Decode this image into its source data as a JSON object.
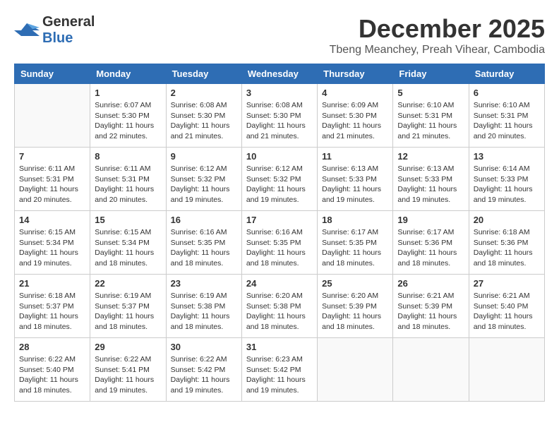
{
  "logo": {
    "general": "General",
    "blue": "Blue"
  },
  "title": {
    "month_year": "December 2025",
    "location": "Tbeng Meanchey, Preah Vihear, Cambodia"
  },
  "days_of_week": [
    "Sunday",
    "Monday",
    "Tuesday",
    "Wednesday",
    "Thursday",
    "Friday",
    "Saturday"
  ],
  "weeks": [
    [
      {
        "day": "",
        "info": ""
      },
      {
        "day": "1",
        "info": "Sunrise: 6:07 AM\nSunset: 5:30 PM\nDaylight: 11 hours\nand 22 minutes."
      },
      {
        "day": "2",
        "info": "Sunrise: 6:08 AM\nSunset: 5:30 PM\nDaylight: 11 hours\nand 21 minutes."
      },
      {
        "day": "3",
        "info": "Sunrise: 6:08 AM\nSunset: 5:30 PM\nDaylight: 11 hours\nand 21 minutes."
      },
      {
        "day": "4",
        "info": "Sunrise: 6:09 AM\nSunset: 5:30 PM\nDaylight: 11 hours\nand 21 minutes."
      },
      {
        "day": "5",
        "info": "Sunrise: 6:10 AM\nSunset: 5:31 PM\nDaylight: 11 hours\nand 21 minutes."
      },
      {
        "day": "6",
        "info": "Sunrise: 6:10 AM\nSunset: 5:31 PM\nDaylight: 11 hours\nand 20 minutes."
      }
    ],
    [
      {
        "day": "7",
        "info": "Sunrise: 6:11 AM\nSunset: 5:31 PM\nDaylight: 11 hours\nand 20 minutes."
      },
      {
        "day": "8",
        "info": "Sunrise: 6:11 AM\nSunset: 5:31 PM\nDaylight: 11 hours\nand 20 minutes."
      },
      {
        "day": "9",
        "info": "Sunrise: 6:12 AM\nSunset: 5:32 PM\nDaylight: 11 hours\nand 19 minutes."
      },
      {
        "day": "10",
        "info": "Sunrise: 6:12 AM\nSunset: 5:32 PM\nDaylight: 11 hours\nand 19 minutes."
      },
      {
        "day": "11",
        "info": "Sunrise: 6:13 AM\nSunset: 5:33 PM\nDaylight: 11 hours\nand 19 minutes."
      },
      {
        "day": "12",
        "info": "Sunrise: 6:13 AM\nSunset: 5:33 PM\nDaylight: 11 hours\nand 19 minutes."
      },
      {
        "day": "13",
        "info": "Sunrise: 6:14 AM\nSunset: 5:33 PM\nDaylight: 11 hours\nand 19 minutes."
      }
    ],
    [
      {
        "day": "14",
        "info": "Sunrise: 6:15 AM\nSunset: 5:34 PM\nDaylight: 11 hours\nand 19 minutes."
      },
      {
        "day": "15",
        "info": "Sunrise: 6:15 AM\nSunset: 5:34 PM\nDaylight: 11 hours\nand 18 minutes."
      },
      {
        "day": "16",
        "info": "Sunrise: 6:16 AM\nSunset: 5:35 PM\nDaylight: 11 hours\nand 18 minutes."
      },
      {
        "day": "17",
        "info": "Sunrise: 6:16 AM\nSunset: 5:35 PM\nDaylight: 11 hours\nand 18 minutes."
      },
      {
        "day": "18",
        "info": "Sunrise: 6:17 AM\nSunset: 5:35 PM\nDaylight: 11 hours\nand 18 minutes."
      },
      {
        "day": "19",
        "info": "Sunrise: 6:17 AM\nSunset: 5:36 PM\nDaylight: 11 hours\nand 18 minutes."
      },
      {
        "day": "20",
        "info": "Sunrise: 6:18 AM\nSunset: 5:36 PM\nDaylight: 11 hours\nand 18 minutes."
      }
    ],
    [
      {
        "day": "21",
        "info": "Sunrise: 6:18 AM\nSunset: 5:37 PM\nDaylight: 11 hours\nand 18 minutes."
      },
      {
        "day": "22",
        "info": "Sunrise: 6:19 AM\nSunset: 5:37 PM\nDaylight: 11 hours\nand 18 minutes."
      },
      {
        "day": "23",
        "info": "Sunrise: 6:19 AM\nSunset: 5:38 PM\nDaylight: 11 hours\nand 18 minutes."
      },
      {
        "day": "24",
        "info": "Sunrise: 6:20 AM\nSunset: 5:38 PM\nDaylight: 11 hours\nand 18 minutes."
      },
      {
        "day": "25",
        "info": "Sunrise: 6:20 AM\nSunset: 5:39 PM\nDaylight: 11 hours\nand 18 minutes."
      },
      {
        "day": "26",
        "info": "Sunrise: 6:21 AM\nSunset: 5:39 PM\nDaylight: 11 hours\nand 18 minutes."
      },
      {
        "day": "27",
        "info": "Sunrise: 6:21 AM\nSunset: 5:40 PM\nDaylight: 11 hours\nand 18 minutes."
      }
    ],
    [
      {
        "day": "28",
        "info": "Sunrise: 6:22 AM\nSunset: 5:40 PM\nDaylight: 11 hours\nand 18 minutes."
      },
      {
        "day": "29",
        "info": "Sunrise: 6:22 AM\nSunset: 5:41 PM\nDaylight: 11 hours\nand 19 minutes."
      },
      {
        "day": "30",
        "info": "Sunrise: 6:22 AM\nSunset: 5:42 PM\nDaylight: 11 hours\nand 19 minutes."
      },
      {
        "day": "31",
        "info": "Sunrise: 6:23 AM\nSunset: 5:42 PM\nDaylight: 11 hours\nand 19 minutes."
      },
      {
        "day": "",
        "info": ""
      },
      {
        "day": "",
        "info": ""
      },
      {
        "day": "",
        "info": ""
      }
    ]
  ]
}
